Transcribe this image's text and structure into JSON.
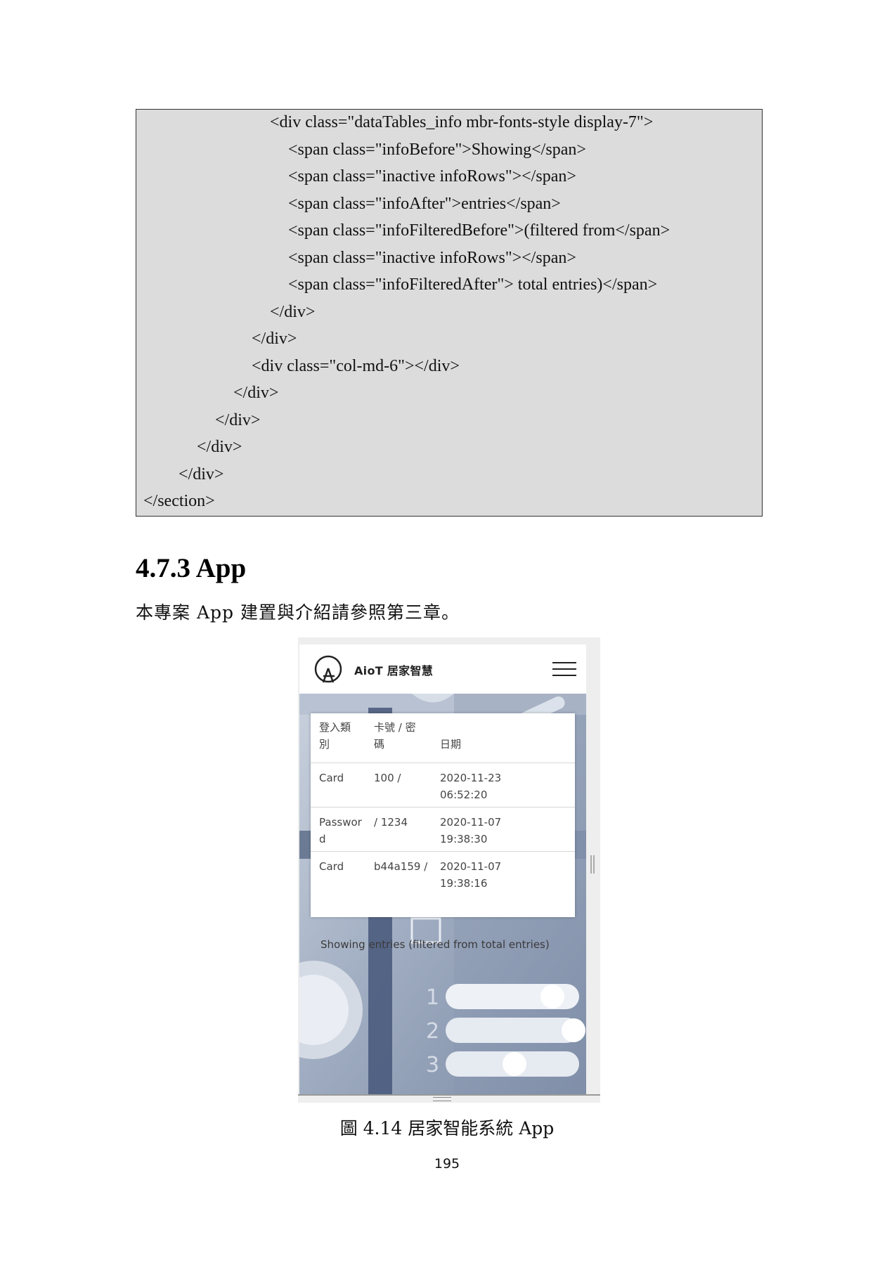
{
  "code_block": {
    "lines": [
      "<div class=\"dataTables_info mbr-fonts-style display-7\">",
      "<span class=\"infoBefore\">Showing</span>",
      "<span class=\"inactive infoRows\"></span>",
      "<span class=\"infoAfter\">entries</span>",
      "<span class=\"infoFilteredBefore\">(filtered from</span>",
      "<span class=\"inactive infoRows\"></span>",
      "<span class=\"infoFilteredAfter\"> total entries)</span>",
      "</div>",
      "</div>",
      "<div class=\"col-md-6\"></div>",
      "</div>",
      "</div>",
      "</div>",
      "</div>",
      "</section>"
    ]
  },
  "section": {
    "heading": "4.7.3 App",
    "body": "本專案 App 建置與介紹請參照第三章。"
  },
  "app": {
    "title": "AioT 居家智慧",
    "table": {
      "headers": [
        "登入類\n別",
        "卡號 / 密\n碼",
        "日期"
      ],
      "rows": [
        [
          "Card",
          "100 /",
          "2020-11-23\n06:52:20"
        ],
        [
          "Passwor\nd",
          "/ 1234",
          "2020-11-07\n19:38:30"
        ],
        [
          "Card",
          "b44a159 /",
          "2020-11-07\n19:38:16"
        ]
      ]
    },
    "info": "Showing entries (filtered from total entries)",
    "switch_labels": [
      "1",
      "2",
      "3"
    ]
  },
  "figure": {
    "caption": "圖 4.14 居家智能系統 App"
  },
  "page_number": "195",
  "colors": {
    "code_bg": "#dcdcdc",
    "app_bg_blue": "#8fa3bf"
  }
}
